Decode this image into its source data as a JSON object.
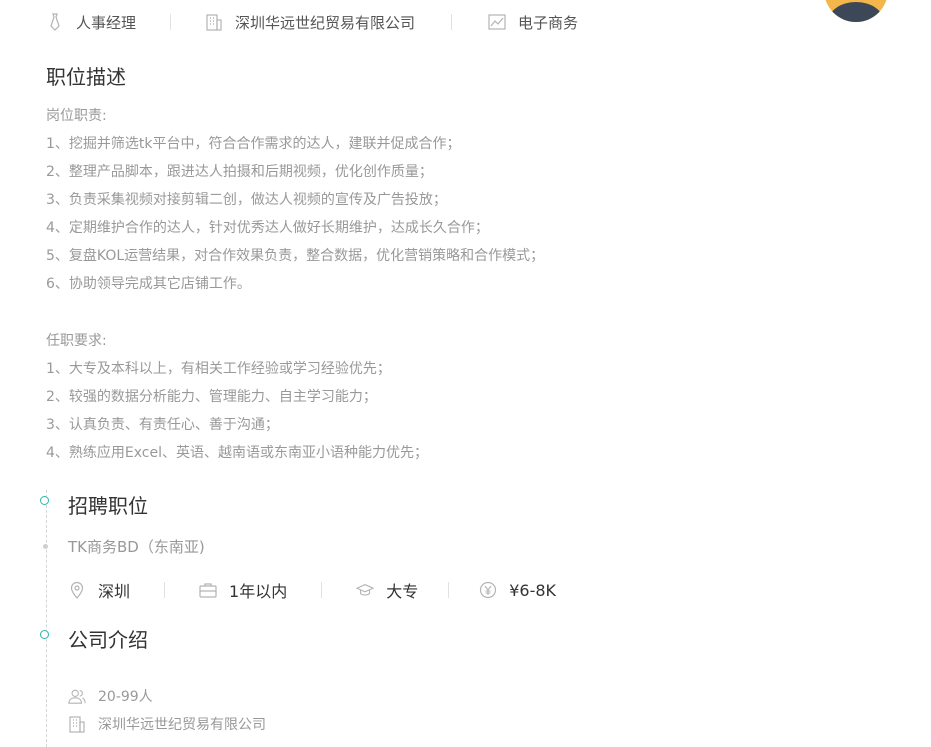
{
  "header": {
    "position": "人事经理",
    "company": "深圳华远世纪贸易有限公司",
    "industry": "电子商务"
  },
  "description": {
    "title": "职位描述",
    "duties_heading": "岗位职责:",
    "duties": [
      "1、挖掘并筛选tk平台中，符合合作需求的达人，建联并促成合作；",
      "2、整理产品脚本，跟进达人拍摄和后期视频，优化创作质量；",
      "3、负责采集视频对接剪辑二创，做达人视频的宣传及广告投放；",
      "4、定期维护合作的达人，针对优秀达人做好长期维护，达成长久合作；",
      "5、复盘KOL运营结果，对合作效果负责，整合数据，优化营销策略和合作模式；",
      "6、协助领导完成其它店铺工作。"
    ],
    "requirements_heading": "任职要求:",
    "requirements": [
      "1、大专及本科以上，有相关工作经验或学习经验优先；",
      "2、较强的数据分析能力、管理能力、自主学习能力；",
      "3、认真负责、有责任心、善于沟通；",
      "4、熟练应用Excel、英语、越南语或东南亚小语种能力优先；"
    ]
  },
  "recruit": {
    "title": "招聘职位",
    "job_title": "TK商务BD（东南亚)",
    "location": "深圳",
    "experience": "1年以内",
    "education": "大专",
    "salary": "¥6-8K"
  },
  "company": {
    "title": "公司介绍",
    "size": "20-99人",
    "name": "深圳华远世纪贸易有限公司"
  },
  "colors": {
    "accent": "#2ab8a8",
    "muted_text": "#999999",
    "icon": "#b3b3b3"
  }
}
